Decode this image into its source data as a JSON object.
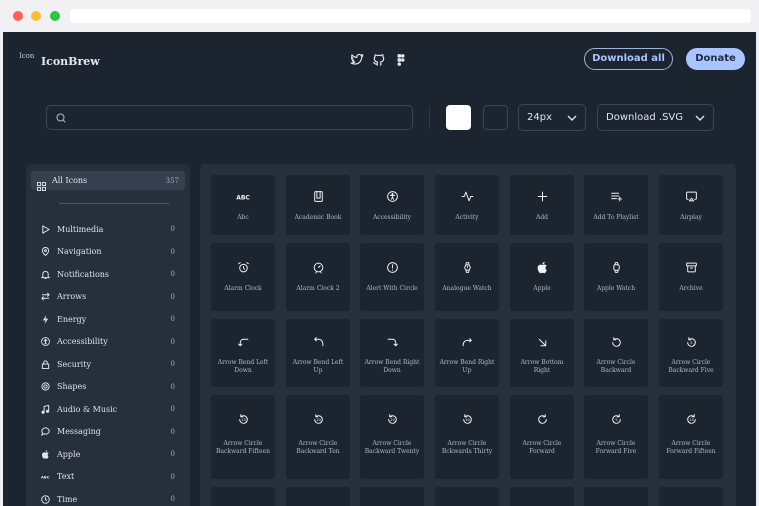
{
  "brand": {
    "logo_alt": "Icon",
    "name": "IconBrew"
  },
  "socials": [
    {
      "name": "twitter-icon"
    },
    {
      "name": "github-icon"
    },
    {
      "name": "figma-icon"
    }
  ],
  "buttons": {
    "download_all": "Download all",
    "donate": "Donate"
  },
  "search": {
    "placeholder": ""
  },
  "colors": {
    "fg_swatch": "#ffffff",
    "bg_swatch": "#1c2430",
    "accent": "#a9c4ff",
    "surface": "#1c2430",
    "panel": "#262f3c"
  },
  "size_select": {
    "value": "24px"
  },
  "download_select": {
    "value": "Download .SVG"
  },
  "sidebar": {
    "all": {
      "label": "All Icons",
      "count": "357"
    },
    "categories": [
      {
        "label": "Multimedia",
        "count": "0",
        "icon": "play-icon"
      },
      {
        "label": "Navigation",
        "count": "0",
        "icon": "map-pin-icon"
      },
      {
        "label": "Notifications",
        "count": "0",
        "icon": "bell-icon"
      },
      {
        "label": "Arrows",
        "count": "0",
        "icon": "swap-arrows-icon"
      },
      {
        "label": "Energy",
        "count": "0",
        "icon": "bolt-icon"
      },
      {
        "label": "Accessibility",
        "count": "0",
        "icon": "accessibility-icon"
      },
      {
        "label": "Security",
        "count": "0",
        "icon": "lock-icon"
      },
      {
        "label": "Shapes",
        "count": "0",
        "icon": "shapes-icon"
      },
      {
        "label": "Audio & Music",
        "count": "0",
        "icon": "music-note-icon"
      },
      {
        "label": "Messaging",
        "count": "0",
        "icon": "chat-bubble-icon"
      },
      {
        "label": "Apple",
        "count": "0",
        "icon": "apple-icon"
      },
      {
        "label": "Text",
        "count": "0",
        "icon": "abc-text-icon"
      },
      {
        "label": "Time",
        "count": "0",
        "icon": "clock-icon"
      }
    ]
  },
  "icons": [
    {
      "label": "Abc",
      "icon": "abc-icon"
    },
    {
      "label": "Academic Book",
      "icon": "book-icon"
    },
    {
      "label": "Accessibility",
      "icon": "accessibility-icon"
    },
    {
      "label": "Activity",
      "icon": "activity-icon"
    },
    {
      "label": "Add",
      "icon": "plus-icon"
    },
    {
      "label": "Add To Playlist",
      "icon": "playlist-add-icon"
    },
    {
      "label": "Airplay",
      "icon": "airplay-icon"
    },
    {
      "label": "Alarm Clock",
      "icon": "alarm-clock-icon"
    },
    {
      "label": "Alarm Clock 2",
      "icon": "alarm-clock-2-icon"
    },
    {
      "label": "Alert With Circle",
      "icon": "alert-circle-icon"
    },
    {
      "label": "Analogue Watch",
      "icon": "analogue-watch-icon"
    },
    {
      "label": "Apple",
      "icon": "apple-icon"
    },
    {
      "label": "Apple Watch",
      "icon": "apple-watch-icon"
    },
    {
      "label": "Archive",
      "icon": "archive-icon"
    },
    {
      "label": "Arrow Bend Left Down",
      "icon": "arrow-bend-left-down-icon"
    },
    {
      "label": "Arrow Bend Left Up",
      "icon": "arrow-bend-left-up-icon"
    },
    {
      "label": "Arrow Bend Right Down",
      "icon": "arrow-bend-right-down-icon"
    },
    {
      "label": "Arrow Bend Right Up",
      "icon": "arrow-bend-right-up-icon"
    },
    {
      "label": "Arrow Bottom Right",
      "icon": "arrow-bottom-right-icon"
    },
    {
      "label": "Arrow Circle Backward",
      "icon": "arrow-circle-backward-icon"
    },
    {
      "label": "Arrow Circle Backward Five",
      "icon": "arrow-circle-backward-five-icon"
    },
    {
      "label": "Arrow Circle Backward Fifteen",
      "icon": "arrow-circle-backward-fifteen-icon"
    },
    {
      "label": "Arrow Circle Backward Ten",
      "icon": "arrow-circle-backward-ten-icon"
    },
    {
      "label": "Arrow Circle Backward Twenty",
      "icon": "arrow-circle-backward-twenty-icon"
    },
    {
      "label": "Arrow Circle Bckwards Thirty",
      "icon": "arrow-circle-backward-thirty-icon"
    },
    {
      "label": "Arrow Circle Forward",
      "icon": "arrow-circle-forward-icon"
    },
    {
      "label": "Arrow Circle Forward Five",
      "icon": "arrow-circle-forward-five-icon"
    },
    {
      "label": "Arrow Circle Forward Fifteen",
      "icon": "arrow-circle-forward-fifteen-icon"
    }
  ]
}
